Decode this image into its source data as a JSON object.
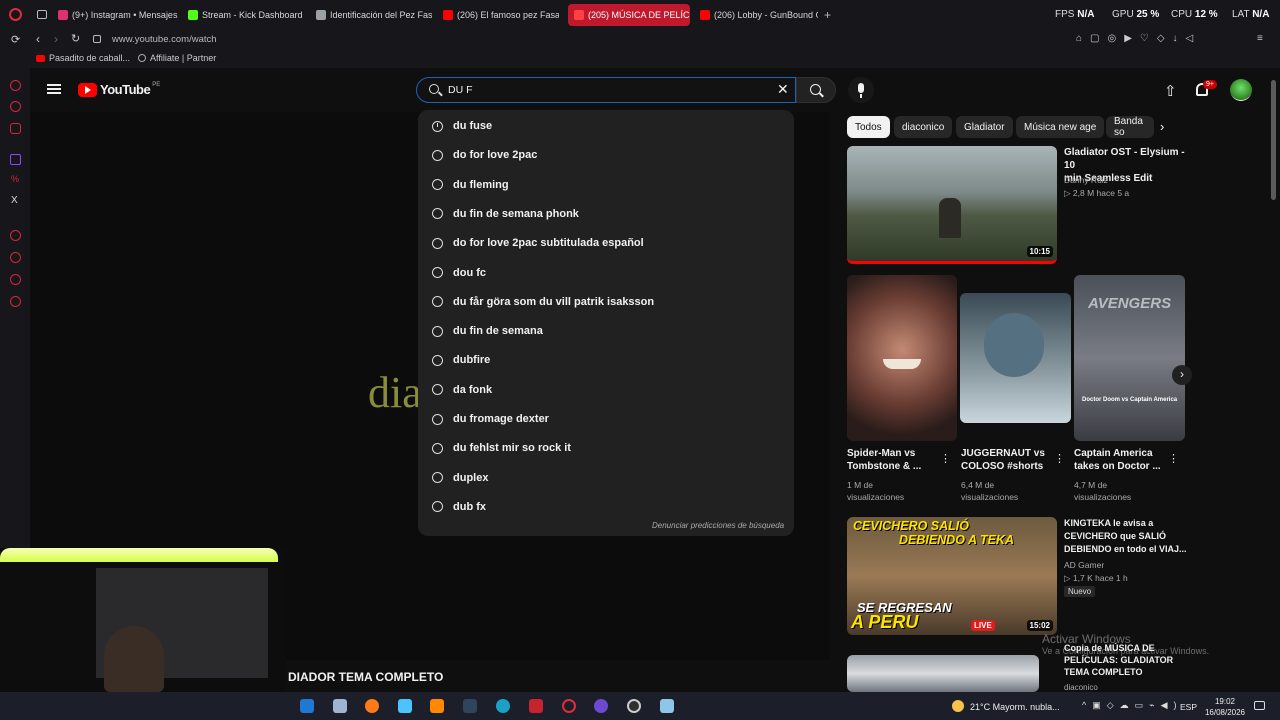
{
  "browser": {
    "tabs": [
      {
        "label": "(9+) Instagram • Mensajes",
        "color": "#e1306c"
      },
      {
        "label": "Stream - Kick Dashboard",
        "color": "#53fc18"
      },
      {
        "label": "Identificación del Pez Fasa",
        "color": "#9aa0a6"
      },
      {
        "label": "(206) El famoso pez Fasac",
        "color": "#ff0000"
      },
      {
        "label": "(205) MÚSICA DE PELÍCUL",
        "color": "#ff0000"
      },
      {
        "label": "(206) Lobby - GunBound O",
        "color": "#ff0000"
      }
    ],
    "stats": [
      {
        "label": "FPS",
        "value": "N/A"
      },
      {
        "label": "GPU",
        "value": "25 %"
      },
      {
        "label": "CPU",
        "value": "12 %"
      },
      {
        "label": "LAT",
        "value": "N/A"
      }
    ],
    "url": "www.youtube.com/watch",
    "bookmarks": [
      "Pasadito de caball...",
      "Affiliate | Partner"
    ]
  },
  "youtube": {
    "logo_text": "YouTube",
    "region": "PE",
    "search_value": "DU F",
    "notification_badge": "9+",
    "suggestions": [
      {
        "text": "du fuse",
        "icon": "history-icon"
      },
      {
        "text": "do for love 2pac",
        "icon": "search-icon"
      },
      {
        "text": "du fleming",
        "icon": "search-icon"
      },
      {
        "text": "du fin de semana phonk",
        "icon": "search-icon"
      },
      {
        "text": "do for love 2pac subtitulada español",
        "icon": "search-icon"
      },
      {
        "text": "dou fc",
        "icon": "search-icon"
      },
      {
        "text": "du får göra som du vill patrik isaksson",
        "icon": "search-icon"
      },
      {
        "text": "du fin de semana",
        "icon": "search-icon"
      },
      {
        "text": "dubfire",
        "icon": "search-icon"
      },
      {
        "text": "da fonk",
        "icon": "search-icon"
      },
      {
        "text": "du fromage dexter",
        "icon": "search-icon"
      },
      {
        "text": "du fehlst mir so rock it",
        "icon": "search-icon"
      },
      {
        "text": "duplex",
        "icon": "search-icon"
      },
      {
        "text": "dub fx",
        "icon": "search-icon"
      }
    ],
    "report_text": "Denunciar predicciones de búsqueda",
    "chips": [
      "Todos",
      "diaconico",
      "Gladiator",
      "Música new age",
      "Banda so"
    ],
    "background_text": "dia",
    "video_title_partial": "DIADOR TEMA COMPLETO",
    "featured": {
      "title_line1": "Gladiator OST - Elysium - 10",
      "title_line2": "min Seamless Edit",
      "channel": "Danny Ruiz",
      "meta": "2,8 M  hace 5 a",
      "duration": "10:15"
    },
    "shorts": [
      {
        "title_line1": "Spider-Man vs",
        "title_line2": "Tombstone & ...",
        "views_line1": "1 M de",
        "views_line2": "visualizaciones"
      },
      {
        "title_line1": "JUGGERNAUT vs",
        "title_line2": "COLOSO #shorts",
        "views_line1": "6,4 M de",
        "views_line2": "visualizaciones"
      },
      {
        "title_line1": "Captain America",
        "title_line2": "takes on Doctor ...",
        "views_line1": "4,7 M de",
        "views_line2": "visualizaciones"
      }
    ],
    "short3_caption": "Doctor Doom vs Captain America",
    "short3_logo": "AVENGERS",
    "video2": {
      "title_line1": "KINGTEKA le avisa a",
      "title_line2": "CEVICHERO que SALIÓ",
      "title_line3": "DEBIENDO en todo el VIAJ...",
      "channel": "AD Gamer",
      "meta": "1,7 K  hace 1 h",
      "badge": "Nuevo",
      "duration": "15:02",
      "thumb_top1": "CEVICHERO SALIÓ",
      "thumb_top2": "DEBIENDO A TEKA",
      "thumb_bot1": "SE REGRESAN",
      "thumb_bot2": "A PERU",
      "live": "LIVE"
    },
    "video3": {
      "title_line1": "Copia de MÚSICA DE",
      "title_line2": "PELÍCULAS: GLADIATOR",
      "title_line3": "TEMA COMPLETO",
      "channel": "diaconico"
    },
    "watermark_line1": "Activar Windows",
    "watermark_line2": "Ve a Configuración para activar Windows."
  },
  "taskbar": {
    "weather": "21°C  Mayorm. nubla...",
    "lang": "ESP",
    "time": "19:02",
    "date": "16/08/2026"
  }
}
